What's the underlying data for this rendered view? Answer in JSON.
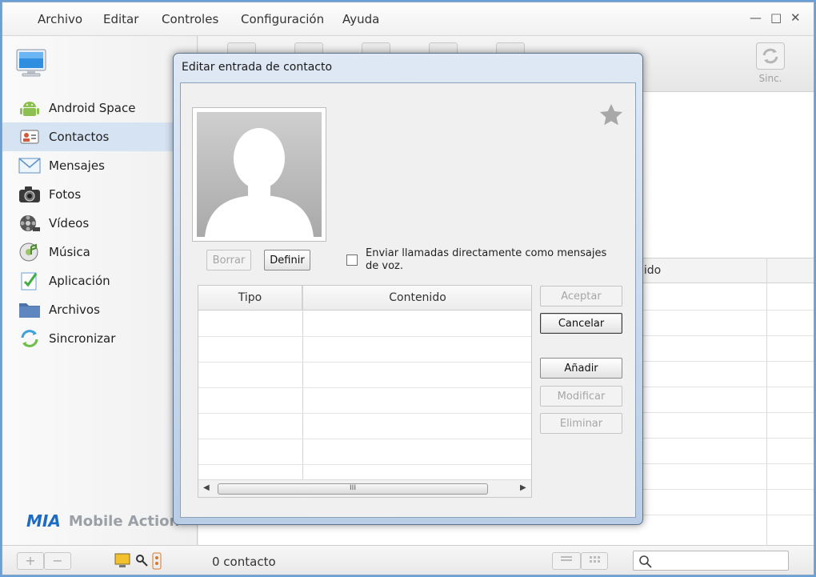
{
  "menu": {
    "items": [
      "Archivo",
      "Editar",
      "Controles",
      "Configuración",
      "Ayuda"
    ],
    "window_controls": {
      "minimize": "—",
      "maximize": "□",
      "close": "✕"
    }
  },
  "sidebar": {
    "items": [
      {
        "label": "Android Space",
        "icon": "android-icon"
      },
      {
        "label": "Contactos",
        "icon": "contacts-card-icon",
        "selected": true
      },
      {
        "label": "Mensajes",
        "icon": "envelope-icon"
      },
      {
        "label": "Fotos",
        "icon": "camera-icon"
      },
      {
        "label": "Vídeos",
        "icon": "film-reel-icon"
      },
      {
        "label": "Música",
        "icon": "music-disc-icon"
      },
      {
        "label": "Aplicación",
        "icon": "checklist-icon"
      },
      {
        "label": "Archivos",
        "icon": "folder-icon"
      },
      {
        "label": "Sincronizar",
        "icon": "sync-arrows-icon"
      }
    ],
    "brand": {
      "logo": "MIA",
      "text": "Mobile Action"
    }
  },
  "main": {
    "sync_label": "Sinc.",
    "column_fragment": "nido"
  },
  "statusbar": {
    "add": "+",
    "remove": "−",
    "count": "0 contacto",
    "search_placeholder": ""
  },
  "dialog": {
    "title": "Editar entrada de contacto",
    "photo_buttons": {
      "clear": "Borrar",
      "set": "Definir"
    },
    "voicemail_checkbox": {
      "label": "Enviar llamadas directamente como mensajes de voz.",
      "checked": false
    },
    "table": {
      "headers": [
        "Tipo",
        "Contenido"
      ],
      "rows": []
    },
    "buttons": {
      "accept": "Aceptar",
      "cancel": "Cancelar",
      "add": "Añadir",
      "modify": "Modificar",
      "delete": "Eliminar"
    },
    "scrollbar_grip": "III"
  },
  "colors": {
    "selection": "#d6e3f2",
    "brand_blue": "#1c6cc4",
    "dialog_frame": "#b9cde5"
  }
}
